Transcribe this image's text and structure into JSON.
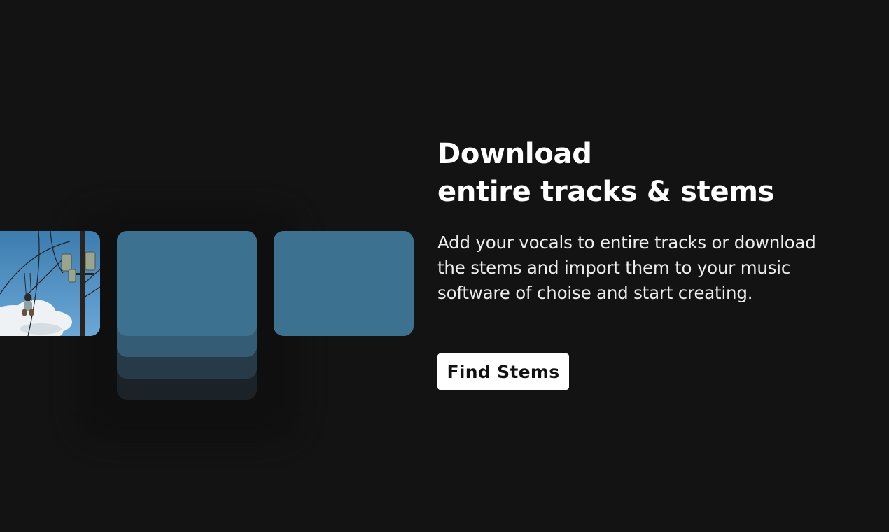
{
  "hero": {
    "headline_line1": "Download",
    "headline_line2": "entire tracks & stems",
    "description_line1": "Add your vocals to entire tracks or download",
    "description_line2": "the stems and import them to your music",
    "description_line3": "software of choise and start creating.",
    "cta_label": "Find Stems"
  },
  "colors": {
    "background": "#131313",
    "tile_blue": "#3d7190",
    "text": "#ffffff",
    "button_bg": "#ffffff",
    "button_text": "#111111"
  }
}
